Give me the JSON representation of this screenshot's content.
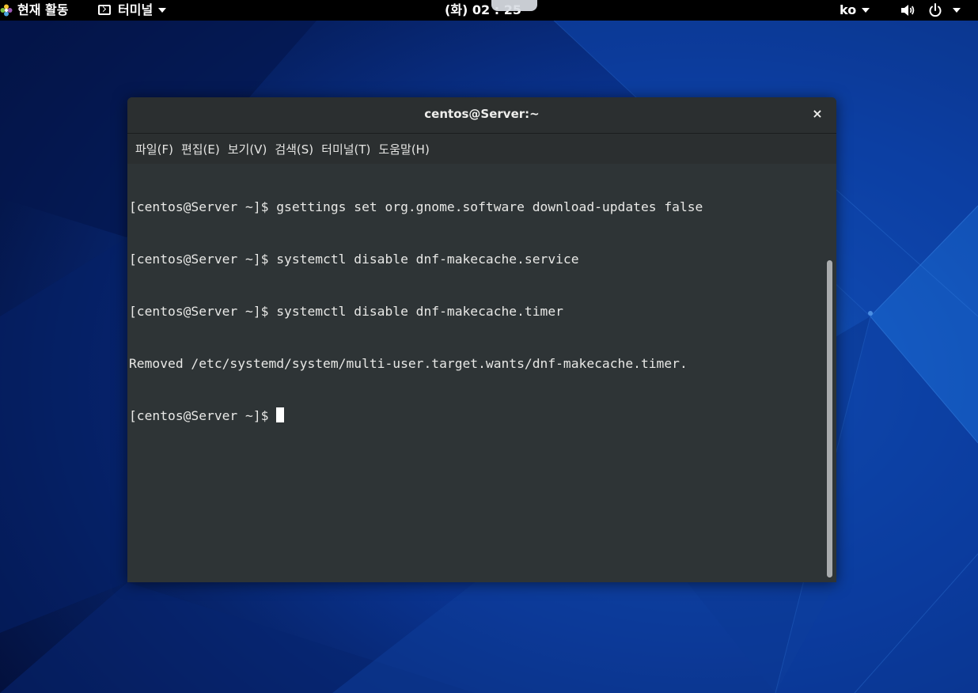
{
  "topbar": {
    "activities_label": "현재 활동",
    "app_menu_label": "터미널",
    "clock": "(화) 02 : 25",
    "language": "ko"
  },
  "icons": {
    "activities": "flower-icon",
    "app_menu": "terminal-icon",
    "volume": "volume-icon",
    "power": "power-icon",
    "close": "close-icon"
  },
  "window": {
    "title": "centos@Server:~",
    "close_glyph": "×",
    "menu": [
      {
        "label": "파일(F)"
      },
      {
        "label": "편집(E)"
      },
      {
        "label": "보기(V)"
      },
      {
        "label": "검색(S)"
      },
      {
        "label": "터미널(T)"
      },
      {
        "label": "도움말(H)"
      }
    ]
  },
  "terminal": {
    "lines": [
      "[centos@Server ~]$ gsettings set org.gnome.software download-updates false",
      "[centos@Server ~]$ systemctl disable dnf-makecache.service",
      "[centos@Server ~]$ systemctl disable dnf-makecache.timer",
      "Removed /etc/systemd/system/multi-user.target.wants/dnf-makecache.timer.",
      "[centos@Server ~]$ "
    ]
  },
  "colors": {
    "desktop_dark": "#03113f",
    "desktop_mid": "#0b3a9e",
    "desktop_light": "#1760c8",
    "terminal_bg": "#2e3436",
    "titlebar_bg": "#2b2f30",
    "text": "#e8e8e6"
  }
}
